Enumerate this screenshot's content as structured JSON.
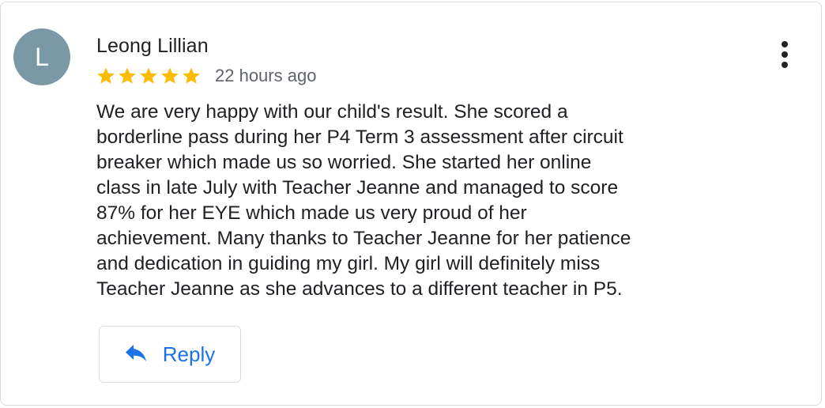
{
  "review": {
    "avatar_letter": "L",
    "avatar_color": "#7a98a5",
    "author": "Leong Lillian",
    "rating": 5,
    "rating_max": 5,
    "star_color": "#fbbc04",
    "time_ago": "22 hours ago",
    "text_lines": [
      "We are very happy with our child's result. She scored a",
      "borderline pass during her P4 Term 3 assessment after circuit",
      "breaker which made us so worried. She started her online",
      "class in late July with Teacher Jeanne and managed to score",
      "87% for her EYE which made us very proud of her",
      "achievement. Many thanks to Teacher Jeanne for her patience",
      "and dedication in guiding my girl. My girl will definitely miss",
      "Teacher Jeanne as she advances to a different teacher in P5."
    ]
  },
  "actions": {
    "reply_label": "Reply",
    "reply_icon": "reply-arrow-icon",
    "more_icon": "more-vert-icon",
    "accent_color": "#1a73e8"
  }
}
